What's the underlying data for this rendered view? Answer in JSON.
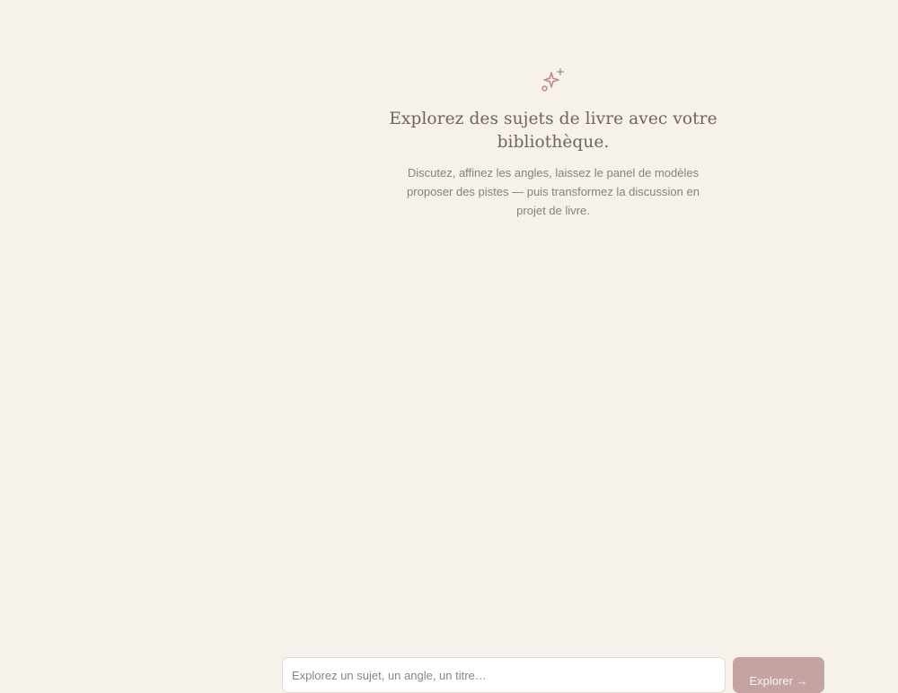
{
  "empty_state": {
    "icon": "sparkles-icon",
    "title": "Explorez des sujets de livre avec votre bibliothèque.",
    "subtitle": "Discutez, affinez les angles, laissez le panel de modèles proposer des pistes — puis transformez la discussion en projet de livre."
  },
  "composer": {
    "placeholder": "Explorez un sujet, un angle, un titre…",
    "submit_label": "Explorer →"
  },
  "colors": {
    "background": "#f6f1ea",
    "accent": "#c5a3a2",
    "icon": "#c08c8b"
  }
}
